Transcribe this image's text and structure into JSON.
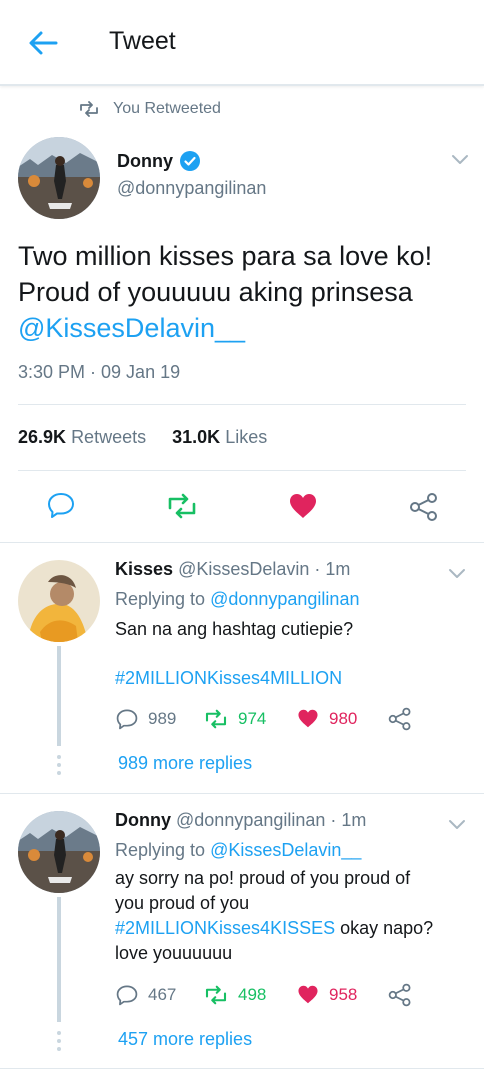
{
  "header": {
    "title": "Tweet"
  },
  "colors": {
    "accent": "#1da1f2",
    "retweet": "#17bf63",
    "like": "#e0245e",
    "muted": "#657786",
    "text": "#14171a"
  },
  "icons": {
    "back": "arrow-left-icon",
    "retweet": "retweet-icon",
    "verified": "verified-badge-icon",
    "reply": "reply-icon",
    "like": "heart-icon",
    "share": "share-icon",
    "caret": "chevron-down-icon"
  },
  "main_tweet": {
    "retweeted_label": "You Retweeted",
    "name": "Donny",
    "handle": "@donnypangilinan",
    "text_line1": "Two million kisses para sa love ko!",
    "text_line2": "Proud of youuuuu aking prinsesa",
    "mention": "@KissesDelavin__",
    "time": "3:30 PM · 09 Jan 19",
    "retweets_count": "26.9K",
    "retweets_label": "Retweets",
    "likes_count": "31.0K",
    "likes_label": "Likes"
  },
  "replies": [
    {
      "name": "Kisses",
      "handle": "@KissesDelavin",
      "time": "· 1m",
      "replying_label": "Replying to",
      "replying_to": "@donnypangilinan",
      "text": "San na ang hashtag cutiepie?",
      "hashtag": "#2MILLIONKisses4MILLION",
      "reply_count": "989",
      "retweet_count": "974",
      "like_count": "980",
      "more_replies": "989 more replies"
    },
    {
      "name": "Donny",
      "handle": "@donnypangilinan",
      "time": "· 1m",
      "replying_label": "Replying to",
      "replying_to": "@KissesDelavin__",
      "text_line1": "ay sorry na po! proud of you proud of",
      "text_line2": "you proud of you",
      "hashtag": "#2MILLIONKisses4KISSES",
      "text_after": " okay napo?",
      "text_line4": "love youuuuuu",
      "reply_count": "467",
      "retweet_count": "498",
      "like_count": "958",
      "more_replies": "457 more replies"
    }
  ]
}
